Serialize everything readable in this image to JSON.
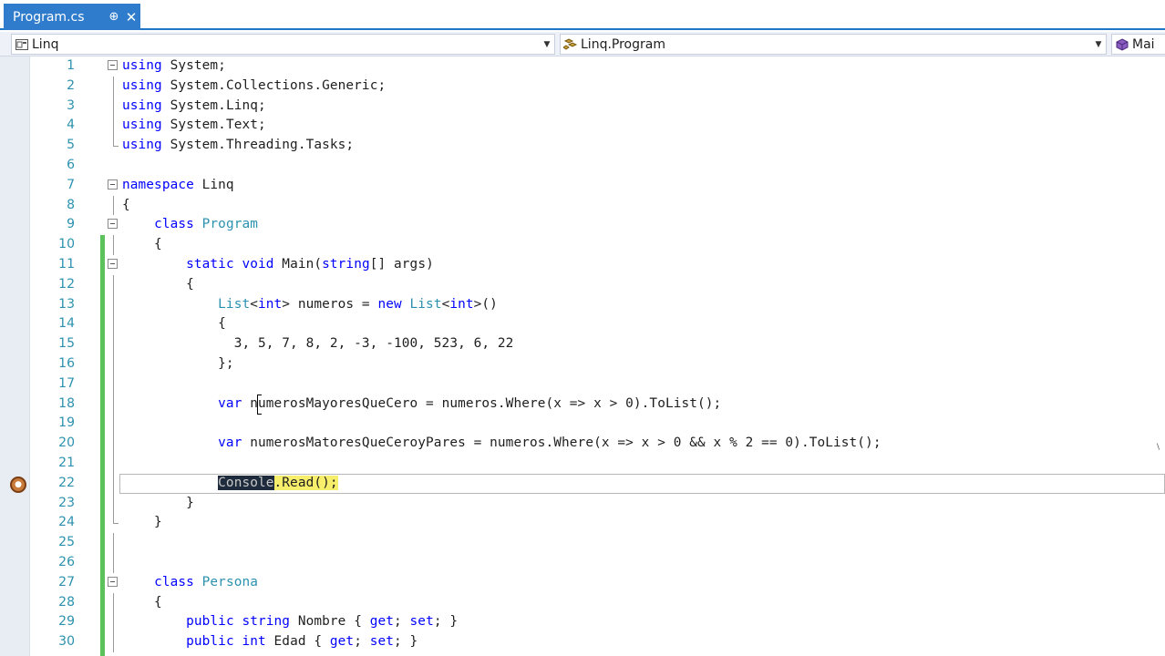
{
  "tab": {
    "title": "Program.cs",
    "pin_glyph": "⊕",
    "close_glyph": "✕"
  },
  "navbar": {
    "project": "Linq",
    "type": "Linq.Program",
    "member": "Mai"
  },
  "editor": {
    "lines": [
      {
        "n": "1",
        "fold": true,
        "guide": "",
        "segs": [
          [
            "kw",
            "using"
          ],
          [
            "t",
            " System;"
          ]
        ]
      },
      {
        "n": "2",
        "fold": false,
        "guide": "line",
        "segs": [
          [
            "kw",
            "using"
          ],
          [
            "t",
            " System.Collections.Generic;"
          ]
        ]
      },
      {
        "n": "3",
        "fold": false,
        "guide": "line",
        "segs": [
          [
            "kw",
            "using"
          ],
          [
            "t",
            " System.Linq;"
          ]
        ]
      },
      {
        "n": "4",
        "fold": false,
        "guide": "line",
        "segs": [
          [
            "kw",
            "using"
          ],
          [
            "t",
            " System.Text;"
          ]
        ]
      },
      {
        "n": "5",
        "fold": false,
        "guide": "end",
        "segs": [
          [
            "kw",
            "using"
          ],
          [
            "t",
            " System.Threading.Tasks;"
          ]
        ]
      },
      {
        "n": "6",
        "fold": false,
        "guide": "",
        "segs": []
      },
      {
        "n": "7",
        "fold": true,
        "guide": "",
        "segs": [
          [
            "kw",
            "namespace"
          ],
          [
            "t",
            " Linq"
          ]
        ]
      },
      {
        "n": "8",
        "fold": false,
        "guide": "line",
        "segs": [
          [
            "t",
            "{"
          ]
        ]
      },
      {
        "n": "9",
        "fold": true,
        "guide": "",
        "segs": [
          [
            "t",
            "    "
          ],
          [
            "kw",
            "class"
          ],
          [
            "t",
            " "
          ],
          [
            "ty",
            "Program"
          ]
        ]
      },
      {
        "n": "10",
        "fold": false,
        "guide": "line",
        "segs": [
          [
            "t",
            "    {"
          ]
        ]
      },
      {
        "n": "11",
        "fold": true,
        "guide": "",
        "segs": [
          [
            "t",
            "        "
          ],
          [
            "kw",
            "static"
          ],
          [
            "t",
            " "
          ],
          [
            "kw",
            "void"
          ],
          [
            "t",
            " Main("
          ],
          [
            "kw",
            "string"
          ],
          [
            "t",
            "[] args)"
          ]
        ]
      },
      {
        "n": "12",
        "fold": false,
        "guide": "line",
        "segs": [
          [
            "t",
            "        {"
          ]
        ]
      },
      {
        "n": "13",
        "fold": false,
        "guide": "line",
        "segs": [
          [
            "t",
            "            "
          ],
          [
            "ty",
            "List"
          ],
          [
            "t",
            "<"
          ],
          [
            "kw",
            "int"
          ],
          [
            "t",
            "> numeros = "
          ],
          [
            "kw",
            "new"
          ],
          [
            "t",
            " "
          ],
          [
            "ty",
            "List"
          ],
          [
            "t",
            "<"
          ],
          [
            "kw",
            "int"
          ],
          [
            "t",
            ">()"
          ]
        ]
      },
      {
        "n": "14",
        "fold": false,
        "guide": "line",
        "segs": [
          [
            "t",
            "            {"
          ]
        ]
      },
      {
        "n": "15",
        "fold": false,
        "guide": "line",
        "segs": [
          [
            "t",
            "              3, 5, 7, 8, 2, -3, -100, 523, 6, 22"
          ]
        ]
      },
      {
        "n": "16",
        "fold": false,
        "guide": "line",
        "segs": [
          [
            "t",
            "            };"
          ]
        ]
      },
      {
        "n": "17",
        "fold": false,
        "guide": "line",
        "segs": []
      },
      {
        "n": "18",
        "fold": false,
        "guide": "line",
        "segs": [
          [
            "t",
            "            "
          ],
          [
            "kw",
            "var"
          ],
          [
            "t",
            " numerosMayoresQueCero = numeros.Where(x => x > 0).ToList();"
          ]
        ]
      },
      {
        "n": "19",
        "fold": false,
        "guide": "line",
        "segs": []
      },
      {
        "n": "20",
        "fold": false,
        "guide": "line",
        "segs": [
          [
            "t",
            "            "
          ],
          [
            "kw",
            "var"
          ],
          [
            "t",
            " numerosMatoresQueCeroyPares = numeros.Where(x => x > 0 && x % 2 == 0).ToList();"
          ]
        ]
      },
      {
        "n": "21",
        "fold": false,
        "guide": "line",
        "segs": []
      },
      {
        "n": "22",
        "fold": false,
        "guide": "line",
        "segs": [
          [
            "t",
            "            "
          ],
          [
            "sel",
            "Console"
          ],
          [
            "hl",
            ".Read();"
          ]
        ]
      },
      {
        "n": "23",
        "fold": false,
        "guide": "line",
        "segs": [
          [
            "t",
            "        }"
          ]
        ]
      },
      {
        "n": "24",
        "fold": false,
        "guide": "end",
        "segs": [
          [
            "t",
            "    }"
          ]
        ]
      },
      {
        "n": "25",
        "fold": false,
        "guide": "line",
        "segs": []
      },
      {
        "n": "26",
        "fold": false,
        "guide": "line",
        "segs": []
      },
      {
        "n": "27",
        "fold": true,
        "guide": "",
        "segs": [
          [
            "t",
            "    "
          ],
          [
            "kw",
            "class"
          ],
          [
            "t",
            " "
          ],
          [
            "ty",
            "Persona"
          ]
        ]
      },
      {
        "n": "28",
        "fold": false,
        "guide": "line",
        "segs": [
          [
            "t",
            "    {"
          ]
        ]
      },
      {
        "n": "29",
        "fold": false,
        "guide": "line",
        "segs": [
          [
            "t",
            "        "
          ],
          [
            "kw",
            "public"
          ],
          [
            "t",
            " "
          ],
          [
            "kw",
            "string"
          ],
          [
            "t",
            " Nombre { "
          ],
          [
            "kw",
            "get"
          ],
          [
            "t",
            "; "
          ],
          [
            "kw",
            "set"
          ],
          [
            "t",
            "; }"
          ]
        ]
      },
      {
        "n": "30",
        "fold": false,
        "guide": "line",
        "segs": [
          [
            "t",
            "        "
          ],
          [
            "kw",
            "public"
          ],
          [
            "t",
            " "
          ],
          [
            "kw",
            "int"
          ],
          [
            "t",
            " Edad { "
          ],
          [
            "kw",
            "get"
          ],
          [
            "t",
            "; "
          ],
          [
            "kw",
            "set"
          ],
          [
            "t",
            "; }"
          ]
        ]
      }
    ]
  },
  "colors": {
    "tab_active": "#2f7ccc",
    "keyword": "#0000ff",
    "type": "#2b91af",
    "line_number": "#2b91af",
    "change_bar": "#5cc35c",
    "highlight": "#f7ef6c"
  }
}
